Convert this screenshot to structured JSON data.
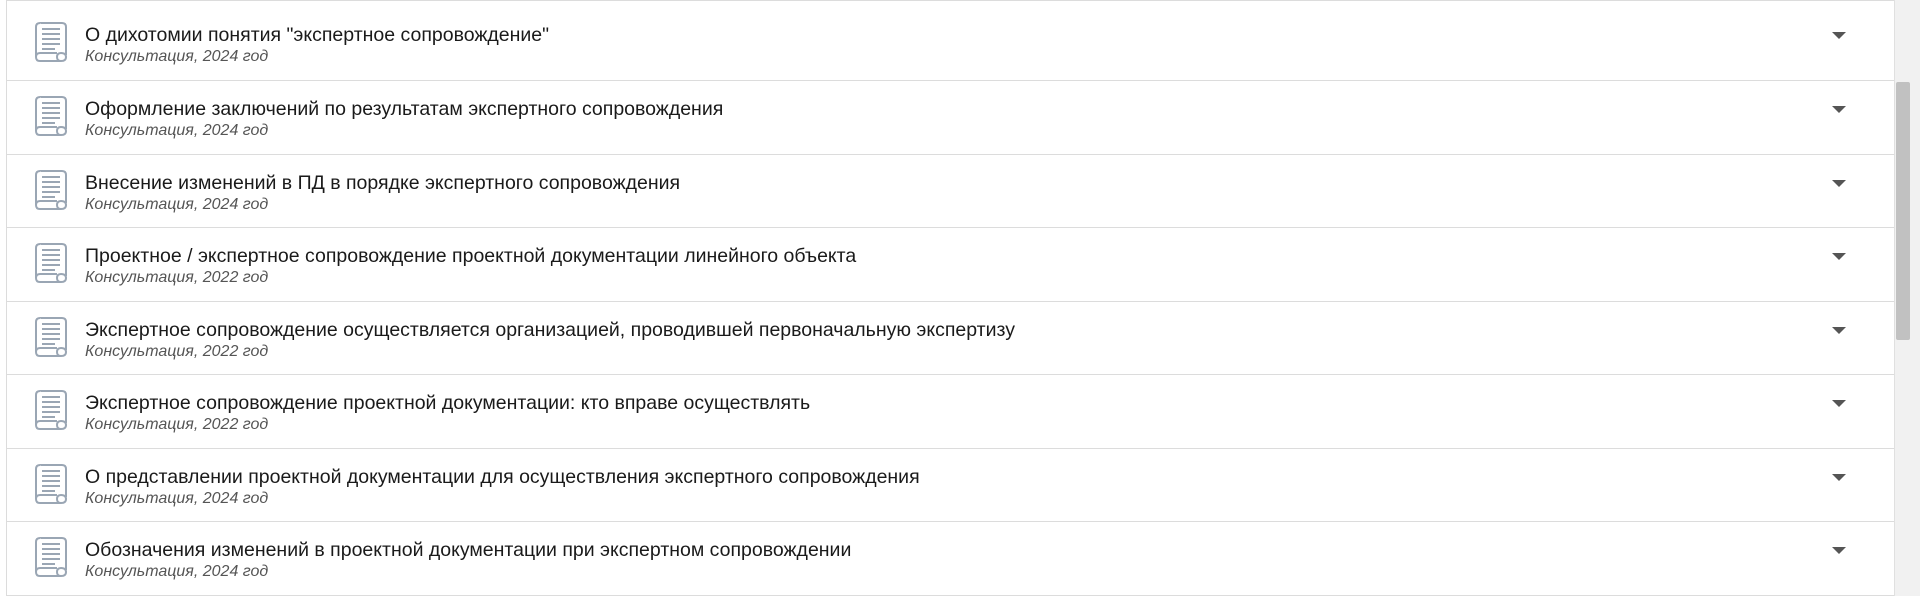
{
  "items": [
    {
      "title": "О дихотомии понятия \"экспертное сопровождение\"",
      "meta": "Консультация, 2024 год"
    },
    {
      "title": "Оформление заключений по результатам экспертного сопровождения",
      "meta": "Консультация, 2024 год"
    },
    {
      "title": "Внесение изменений в ПД в порядке экспертного сопровождения",
      "meta": "Консультация, 2024 год"
    },
    {
      "title": "Проектное / экспертное сопровождение проектной документации линейного объекта",
      "meta": "Консультация, 2022 год"
    },
    {
      "title": "Экспертное сопровождение осуществляется организацией, проводившей первоначальную экспертизу",
      "meta": "Консультация, 2022 год"
    },
    {
      "title": "Экспертное сопровождение проектной документации: кто вправе осуществлять",
      "meta": "Консультация, 2022 год"
    },
    {
      "title": "О представлении проектной документации для осуществления экспертного сопровождения",
      "meta": "Консультация, 2024 год"
    },
    {
      "title": "Обозначения изменений в проектной документации при экспертном сопровождении",
      "meta": "Консультация, 2024 год"
    }
  ],
  "icons": {
    "document": "document-scroll-icon",
    "expand": "chevron-down-icon"
  },
  "colors": {
    "icon": "#9aa6b4",
    "chevron": "#555555",
    "divider": "#dcdcdc"
  }
}
